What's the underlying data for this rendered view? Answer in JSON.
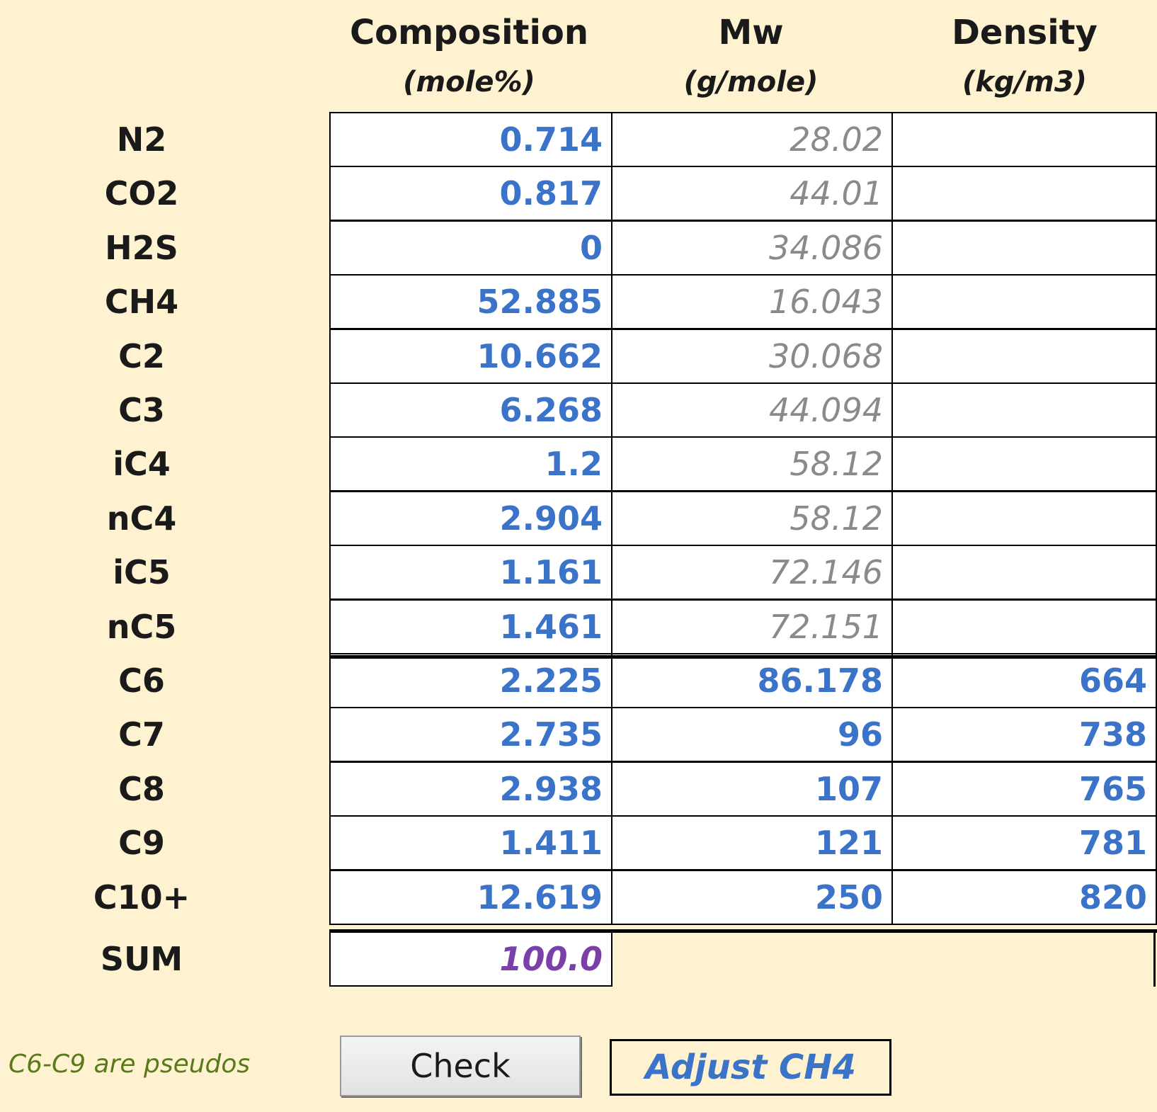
{
  "headers": {
    "composition": {
      "title": "Composition",
      "unit": "(mole%)"
    },
    "mw": {
      "title": "Mw",
      "unit": "(g/mole)"
    },
    "density": {
      "title": "Density",
      "unit": "(kg/m3)"
    }
  },
  "rows": [
    {
      "component": "N2",
      "composition": "0.714",
      "mw": "28.02",
      "density": ""
    },
    {
      "component": "CO2",
      "composition": "0.817",
      "mw": "44.01",
      "density": ""
    },
    {
      "component": "H2S",
      "composition": "0",
      "mw": "34.086",
      "density": ""
    },
    {
      "component": "CH4",
      "composition": "52.885",
      "mw": "16.043",
      "density": ""
    },
    {
      "component": "C2",
      "composition": "10.662",
      "mw": "30.068",
      "density": ""
    },
    {
      "component": "C3",
      "composition": "6.268",
      "mw": "44.094",
      "density": ""
    },
    {
      "component": "iC4",
      "composition": "1.2",
      "mw": "58.12",
      "density": ""
    },
    {
      "component": "nC4",
      "composition": "2.904",
      "mw": "58.12",
      "density": ""
    },
    {
      "component": "iC5",
      "composition": "1.161",
      "mw": "72.146",
      "density": ""
    },
    {
      "component": "nC5",
      "composition": "1.461",
      "mw": "72.151",
      "density": ""
    },
    {
      "component": "C6",
      "composition": "2.225",
      "mw": "86.178",
      "density": "664"
    },
    {
      "component": "C7",
      "composition": "2.735",
      "mw": "96",
      "density": "738"
    },
    {
      "component": "C8",
      "composition": "2.938",
      "mw": "107",
      "density": "765"
    },
    {
      "component": "C9",
      "composition": "1.411",
      "mw": "121",
      "density": "781"
    },
    {
      "component": "C10+",
      "composition": "12.619",
      "mw": "250",
      "density": "820"
    }
  ],
  "sum": {
    "label": "SUM",
    "value": "100.0"
  },
  "note": "C6-C9 are pseudos",
  "buttons": {
    "check": "Check",
    "adjust": "Adjust CH4"
  },
  "colors": {
    "background": "#FEF2D0",
    "input_value": "#3B73C8",
    "default_value": "#8A8A8A",
    "sum_value": "#7A3FA8",
    "note_text": "#5A7A1A"
  }
}
